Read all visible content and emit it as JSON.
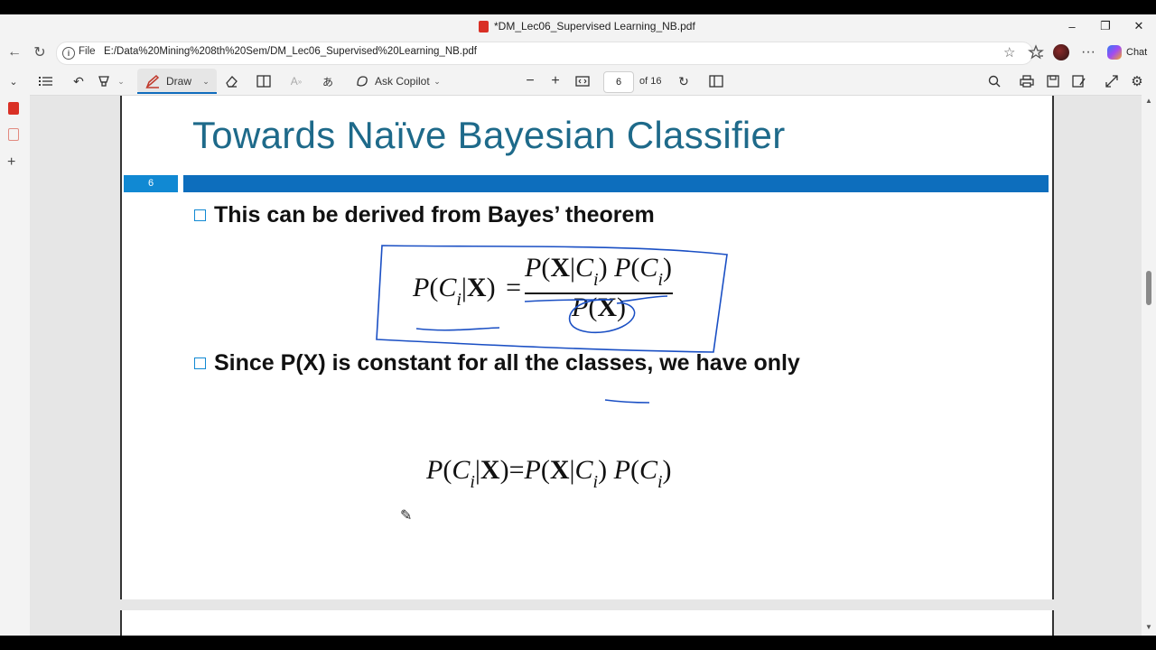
{
  "window": {
    "title": "*DM_Lec06_Supervised Learning_NB.pdf",
    "minimize": "–",
    "maximize": "❐",
    "close": "✕"
  },
  "addressbar": {
    "back": "←",
    "refresh": "↻",
    "scheme_label": "File",
    "url": "E:/Data%20Mining%208th%20Sem/DM_Lec06_Supervised%20Learning_NB.pdf",
    "chat_label": "Chat"
  },
  "toolbar": {
    "draw_label": "Draw",
    "ask_copilot_label": "Ask Copilot",
    "page_number": "6",
    "page_total": "of 16"
  },
  "slide": {
    "title": "Towards Naïve Bayesian Classifier",
    "slide_number": "6",
    "bullet1": "This can be derived from Bayes’ theorem",
    "bullet2": "Since P(X) is constant for all the classes, we have only"
  },
  "formulas": {
    "P": "P",
    "C": "C",
    "X": "X",
    "i": "i",
    "eq": "=",
    "bar": "|",
    "lp": "(",
    "rp": ")"
  },
  "colors": {
    "title": "#1e6a8a",
    "accent_bar": "#0d6ebd",
    "number_bar": "#1189d3",
    "ink": "#1a4fc4"
  }
}
